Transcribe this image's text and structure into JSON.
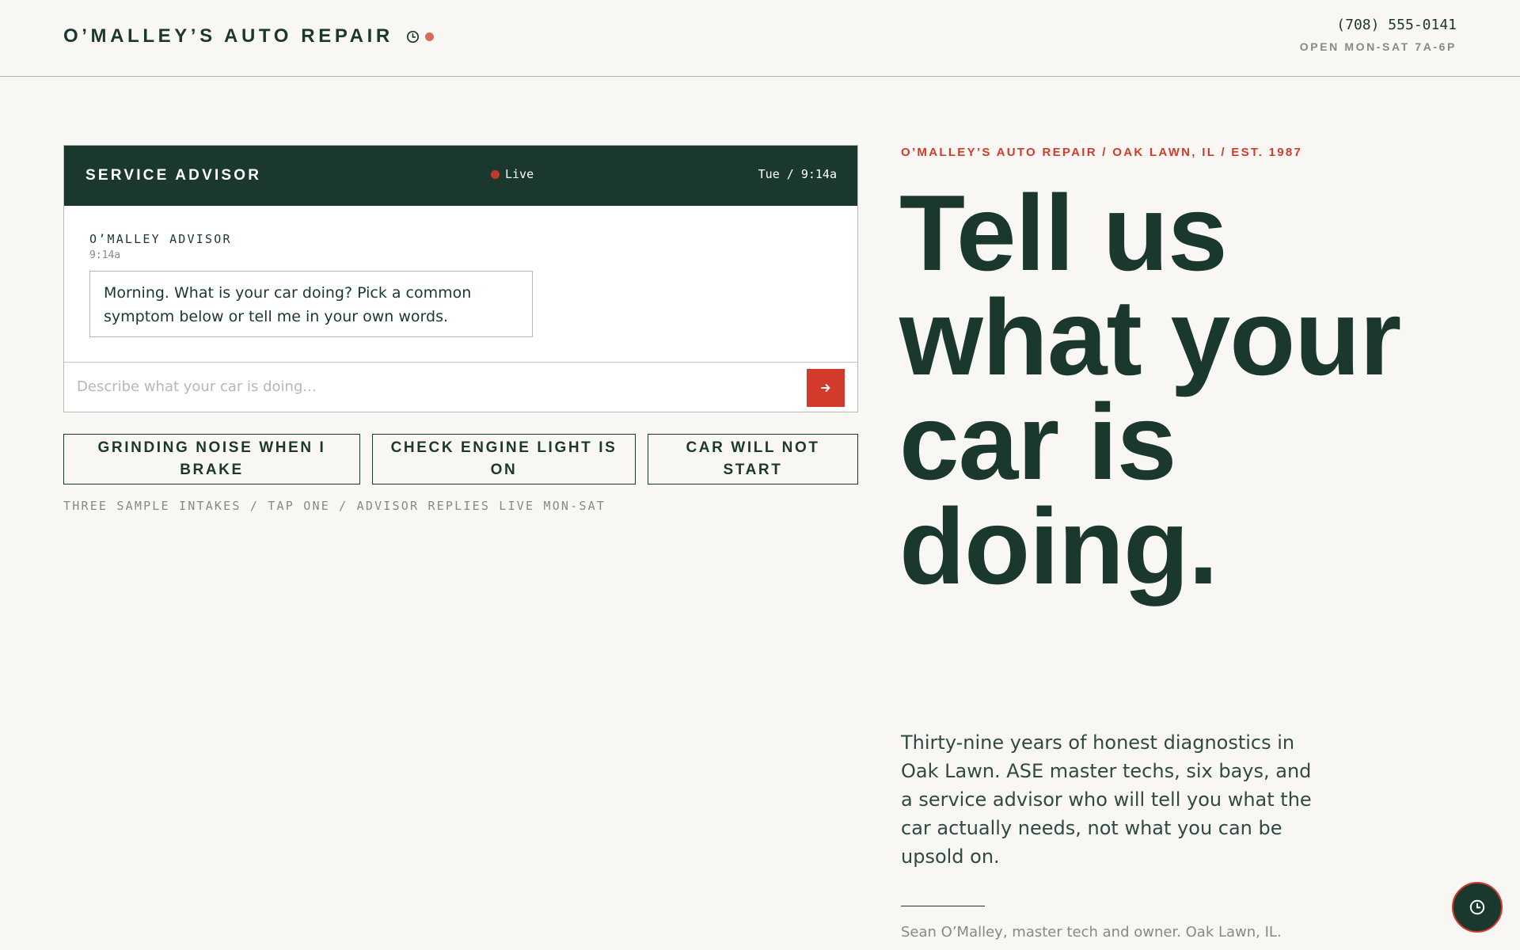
{
  "header": {
    "brand": "O’MALLEY’S AUTO REPAIR",
    "brand_icon": "clock-icon",
    "phone": "(708) 555-0141",
    "hours": "OPEN MON-SAT 7A-6P"
  },
  "chat": {
    "title": "SERVICE ADVISOR",
    "status": "Live",
    "timestamp": "Tue / 9:14a",
    "message": {
      "sender": "O’MALLEY ADVISOR",
      "time": "9:14a",
      "text": "Morning. What is your car doing? Pick a common symptom below or tell me in your own words."
    },
    "input_placeholder": "Describe what your car is doing...",
    "input_value": "",
    "send_icon": "arrow-right-icon"
  },
  "chips": [
    "GRINDING NOISE WHEN I BRAKE",
    "CHECK ENGINE LIGHT IS ON",
    "CAR WILL NOT START"
  ],
  "chips_note": "THREE SAMPLE INTAKES / TAP ONE / ADVISOR REPLIES LIVE MON-SAT",
  "hero": {
    "eyebrow": "O’MALLEY’S AUTO REPAIR / OAK LAWN, IL / EST. 1987",
    "title": "Tell us what your car is doing.",
    "body": "Thirty-nine years of honest diagnostics in Oak Lawn. ASE master techs, six bays, and a service advisor who will tell you what the car actually needs, not what you can be upsold on.",
    "byline": "Sean O’Malley, master tech and owner. Oak Lawn, IL."
  },
  "fab_icon": "clock-icon",
  "colors": {
    "primary": "#1b382e",
    "accent": "#d23a2c",
    "background": "#f9f7f3",
    "muted": "#8a8883"
  }
}
